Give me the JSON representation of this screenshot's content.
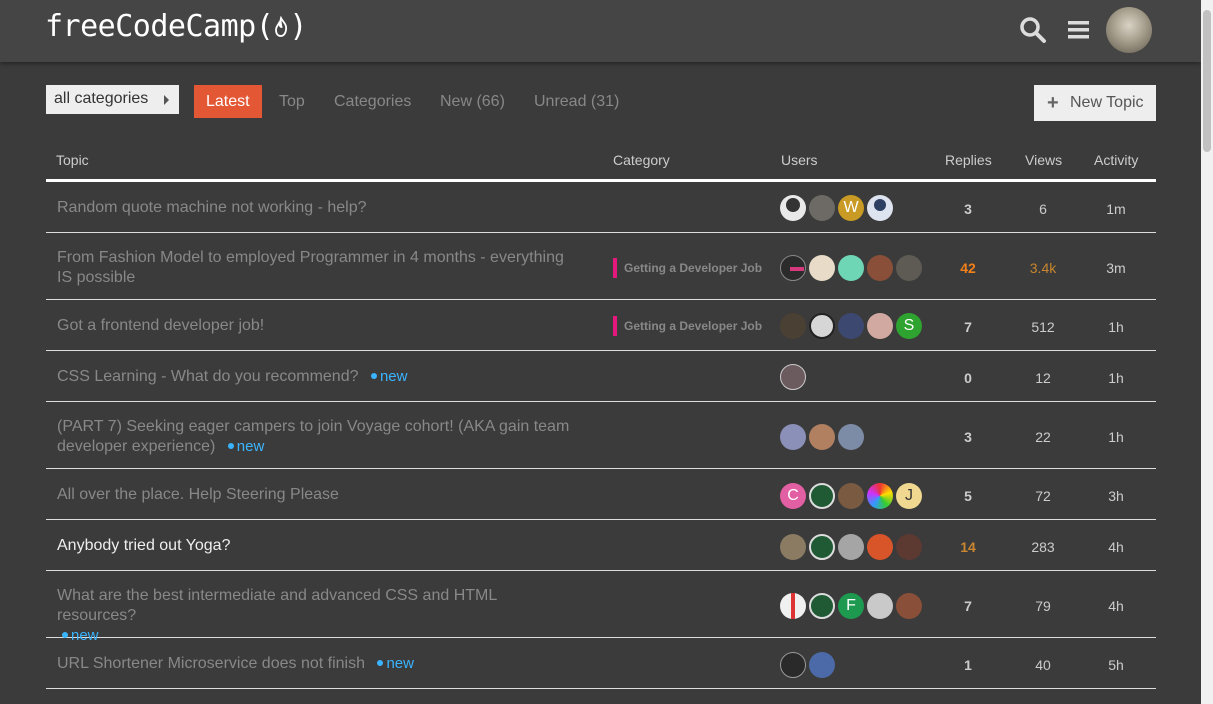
{
  "header": {
    "logo_text": "freeCodeCamp(",
    "logo_close": ")",
    "icons": [
      "search-icon",
      "hamburger-menu-icon",
      "user-avatar"
    ]
  },
  "nav": {
    "category_dropdown": "all categories",
    "tabs": [
      "Latest",
      "Top",
      "Categories",
      "New (66)",
      "Unread (31)"
    ],
    "active_tab": "Latest",
    "new_topic_label": "New Topic"
  },
  "table": {
    "headers": [
      "Topic",
      "Category",
      "Users",
      "Replies",
      "Views",
      "Activity"
    ],
    "rows": [
      {
        "topic": "Random quote machine not working - help?",
        "new": "",
        "category": "",
        "replies": "3",
        "views": "6",
        "activity": "1m"
      },
      {
        "topic": "From Fashion Model to employed Programmer in 4 months - everything IS possible",
        "new": "",
        "category": "Getting a Developer Job",
        "replies": "42",
        "views": "3.4k",
        "activity": "3m"
      },
      {
        "topic": "Got a frontend developer job!",
        "new": "",
        "category": "Getting a Developer Job",
        "replies": "7",
        "views": "512",
        "activity": "1h"
      },
      {
        "topic": "CSS Learning - What do you recommend?",
        "new": "new",
        "category": "",
        "replies": "0",
        "views": "12",
        "activity": "1h"
      },
      {
        "topic": "(PART 7) Seeking eager campers to join Voyage cohort! (AKA gain team developer experience)",
        "new": "new",
        "category": "",
        "replies": "3",
        "views": "22",
        "activity": "1h"
      },
      {
        "topic": "All over the place. Help Steering Please",
        "new": "",
        "category": "",
        "replies": "5",
        "views": "72",
        "activity": "3h"
      },
      {
        "topic": "Anybody tried out Yoga?",
        "new": "",
        "category": "",
        "replies": "14",
        "views": "283",
        "activity": "4h"
      },
      {
        "topic": "What are the best intermediate and advanced CSS and HTML resources?",
        "new": "new",
        "category": "",
        "replies": "7",
        "views": "79",
        "activity": "4h"
      },
      {
        "topic": "URL Shortener Microservice does not finish",
        "new": "new",
        "category": "",
        "replies": "1",
        "views": "40",
        "activity": "5h"
      }
    ],
    "avatar_letters": {
      "r0_w": "W",
      "r5_c": "C",
      "r5_j": "J",
      "r7_f": "F",
      "r2_s": "S"
    }
  },
  "colors": {
    "accent": "#e45735",
    "category_bar": "#e5187d",
    "new_badge": "#3ab4ff",
    "hot_replies": "#f37f18"
  }
}
